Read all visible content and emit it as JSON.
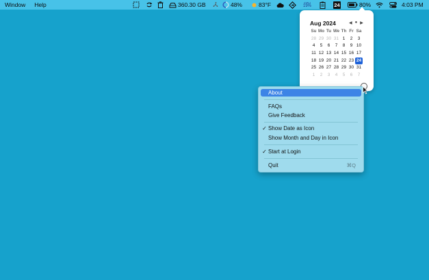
{
  "menubar": {
    "left_items": [
      "Window",
      "Help"
    ],
    "disk_space": "360.30 GB",
    "battery_small_percent": "48%",
    "weather_temp": "83°F",
    "cpu_label": "CPU",
    "cpu_value": "19%",
    "calendar_day": "24",
    "battery_percent": "80%",
    "clock": "4:03 PM"
  },
  "calendar": {
    "month_year": "Aug 2024",
    "weekday_headers": [
      "Su",
      "Mo",
      "Tu",
      "We",
      "Th",
      "Fr",
      "Sa"
    ],
    "days": [
      {
        "d": "28",
        "dim": true
      },
      {
        "d": "29",
        "dim": true
      },
      {
        "d": "30",
        "dim": true
      },
      {
        "d": "31",
        "dim": true
      },
      {
        "d": "1"
      },
      {
        "d": "2"
      },
      {
        "d": "3"
      },
      {
        "d": "4"
      },
      {
        "d": "5"
      },
      {
        "d": "6"
      },
      {
        "d": "7"
      },
      {
        "d": "8"
      },
      {
        "d": "9"
      },
      {
        "d": "10"
      },
      {
        "d": "11"
      },
      {
        "d": "12"
      },
      {
        "d": "13"
      },
      {
        "d": "14"
      },
      {
        "d": "15"
      },
      {
        "d": "16"
      },
      {
        "d": "17"
      },
      {
        "d": "18"
      },
      {
        "d": "19"
      },
      {
        "d": "20"
      },
      {
        "d": "21"
      },
      {
        "d": "22"
      },
      {
        "d": "23"
      },
      {
        "d": "24",
        "today": true
      },
      {
        "d": "25"
      },
      {
        "d": "26"
      },
      {
        "d": "27"
      },
      {
        "d": "28"
      },
      {
        "d": "29"
      },
      {
        "d": "30"
      },
      {
        "d": "31"
      },
      {
        "d": "1",
        "dim": true
      },
      {
        "d": "2",
        "dim": true
      },
      {
        "d": "3",
        "dim": true
      },
      {
        "d": "4",
        "dim": true
      },
      {
        "d": "5",
        "dim": true
      },
      {
        "d": "6",
        "dim": true
      },
      {
        "d": "7",
        "dim": true
      }
    ],
    "today_color": "#1d61d8"
  },
  "menu": {
    "about": "About",
    "faqs": "FAQs",
    "give_feedback": "Give Feedback",
    "show_date_as_icon": "Show Date as Icon",
    "show_month_day": "Show Month and Day in Icon",
    "start_at_login": "Start at Login",
    "quit": "Quit",
    "quit_shortcut": "⌘Q",
    "checkmark": "✓",
    "highlight_color": "#3d84e6"
  },
  "colors": {
    "desktop": "#16a2cc",
    "menubar": "#47c2e8"
  }
}
